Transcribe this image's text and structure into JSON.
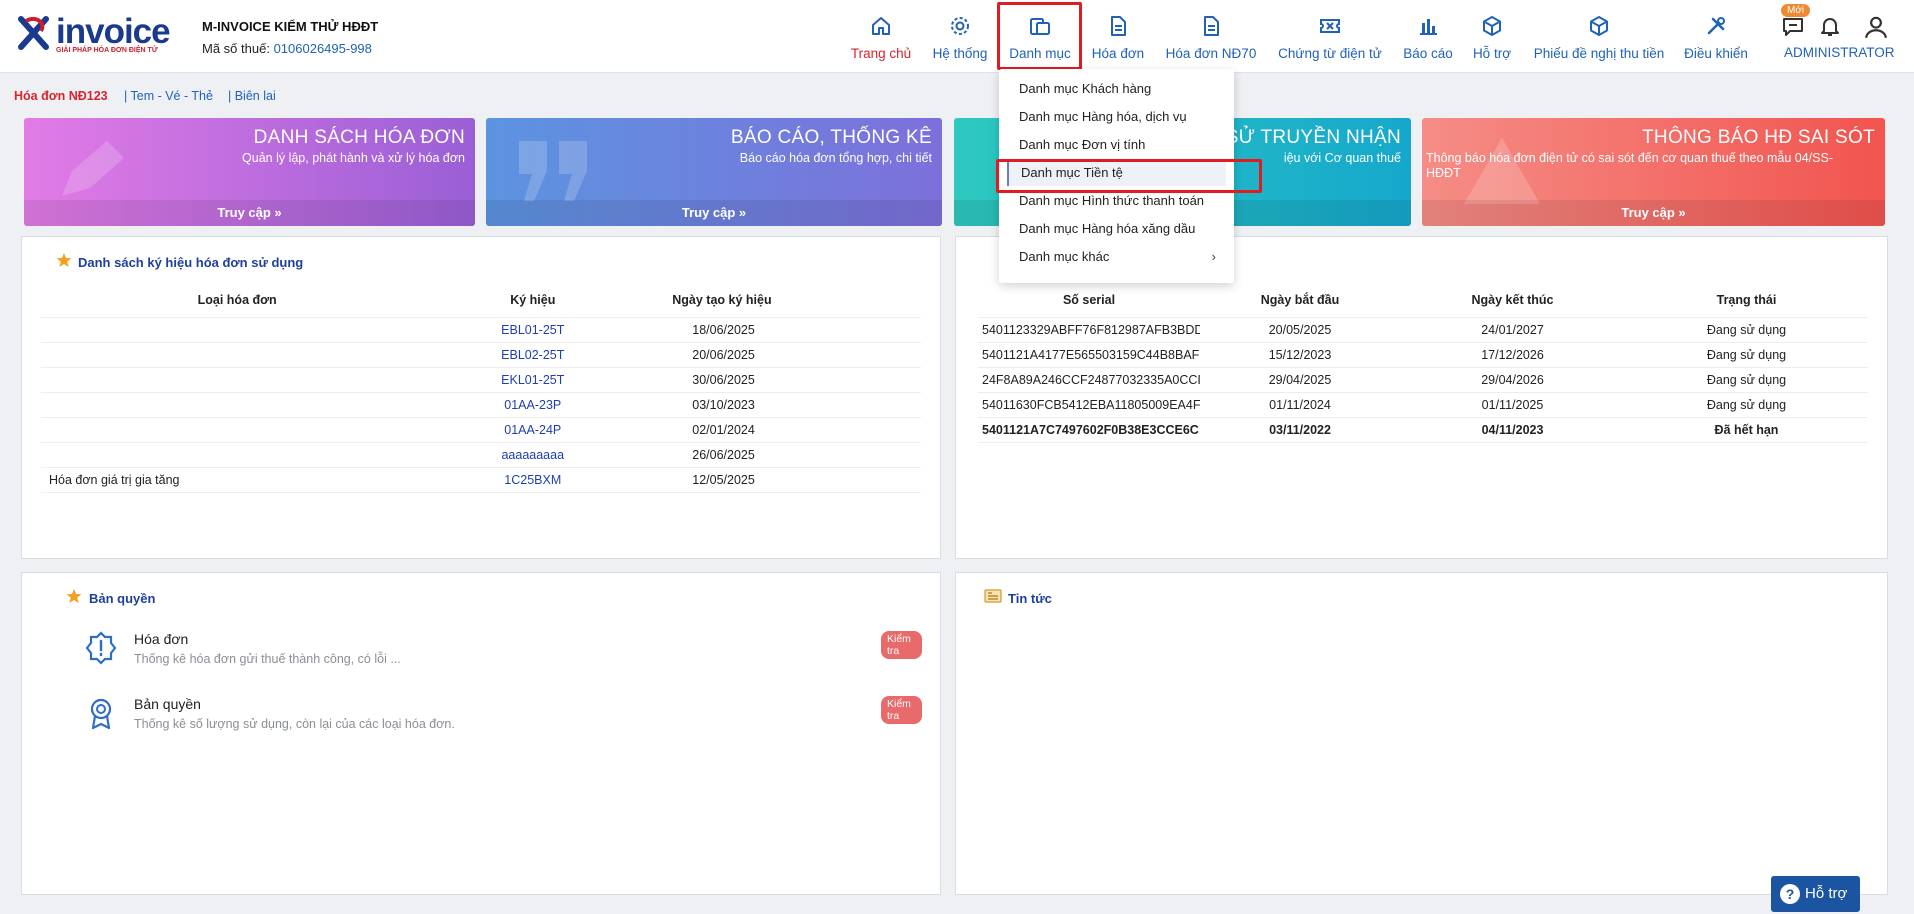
{
  "brand": {
    "logo_text": "invoice",
    "tagline": "GIẢI PHÁP HÓA ĐƠN ĐIỆN TỬ"
  },
  "company": {
    "name": "M-INVOICE KIỂM THỬ HĐĐT",
    "tax_label": "Mã số thuế:",
    "tax_code": "0106026495-998"
  },
  "nav": {
    "items": [
      {
        "label": "Trang chủ",
        "icon": "home-icon"
      },
      {
        "label": "Hệ thống",
        "icon": "gear-icon"
      },
      {
        "label": "Danh mục",
        "icon": "catalog-icon"
      },
      {
        "label": "Hóa đơn",
        "icon": "document-icon"
      },
      {
        "label": "Hóa đơn NĐ70",
        "icon": "document-icon"
      },
      {
        "label": "Chứng từ điện tử",
        "icon": "ticket-icon"
      },
      {
        "label": "Báo cáo",
        "icon": "bar-chart-icon"
      },
      {
        "label": "Hỗ trợ",
        "icon": "box-icon"
      },
      {
        "label": "Phiếu đề nghị thu tiền",
        "icon": "box-icon"
      },
      {
        "label": "Điều khiển",
        "icon": "tools-icon"
      }
    ],
    "new_badge": "Mới",
    "admin": "ADMINISTRATOR"
  },
  "subtabs": [
    "Hóa đơn NĐ123",
    "| Tem - Vé - Thẻ",
    "| Biên lai"
  ],
  "banners": [
    {
      "title": "DANH SÁCH HÓA ĐƠN",
      "desc": "Quản lý lập, phát hành và xử lý hóa đơn",
      "action": "Truy cập",
      "color": "#b55fd8"
    },
    {
      "title": "BÁO CÁO, THỐNG KÊ",
      "desc": "Báo cáo hóa đơn tổng hợp, chi tiết",
      "action": "Truy cập",
      "color": "#6b79d9"
    },
    {
      "title": "SỬ TRUYỀN NHẬN",
      "desc": "iệu với Cơ quan thuế",
      "action": "",
      "color": "#1fb8c8"
    },
    {
      "title": "THÔNG BÁO HĐ SAI SÓT",
      "desc": "Thông báo hóa đơn điện tử có sai sót đến cơ quan thuế theo mẫu 04/SS-HĐĐT",
      "action": "Truy cập",
      "color": "#f2625f"
    }
  ],
  "symbols_panel": {
    "title": "Danh sách ký hiệu hóa đơn sử dụng",
    "headers": [
      "Loại hóa đơn",
      "Ký hiệu",
      "Ngày tạo ký hiệu"
    ],
    "rows": [
      [
        "",
        "EBL01-25T",
        "18/06/2025"
      ],
      [
        "",
        "EBL02-25T",
        "20/06/2025"
      ],
      [
        "",
        "EKL01-25T",
        "30/06/2025"
      ],
      [
        "",
        "01AA-23P",
        "03/10/2023"
      ],
      [
        "",
        "01AA-24P",
        "02/01/2024"
      ],
      [
        "",
        "aaaaaaaaa",
        "26/06/2025"
      ],
      [
        "Hóa đơn giá trị gia tăng",
        "1C25BXM",
        "12/05/2025"
      ]
    ]
  },
  "certs_panel": {
    "headers": [
      "Số serial",
      "Ngày bắt đầu",
      "Ngày kết thúc",
      "Trạng thái"
    ],
    "rows": [
      [
        "5401123329ABFF76F812987AFB3BDD",
        "20/05/2025",
        "24/01/2027",
        "Đang sử dụng"
      ],
      [
        "5401121A4177E565503159C44B8BAF",
        "15/12/2023",
        "17/12/2026",
        "Đang sử dụng"
      ],
      [
        "24F8A89A246CCF24877032335A0CCI",
        "29/04/2025",
        "29/04/2026",
        "Đang sử dụng"
      ],
      [
        "54011630FCB5412EBA11805009EA4F",
        "01/11/2024",
        "01/11/2025",
        "Đang sử dụng"
      ],
      [
        "5401121A7C7497602F0B38E3CCE6C",
        "03/11/2022",
        "04/11/2023",
        "Đã hết hạn"
      ]
    ]
  },
  "license_panel": {
    "title": "Bản quyền",
    "items": [
      {
        "name": "Hóa đơn",
        "desc": "Thống kê hóa đơn gửi thuế thành công, có lỗi ...",
        "action": "Kiểm tra"
      },
      {
        "name": "Bản quyền",
        "desc": "Thống kê số lượng sử dụng, còn lại của các loại hóa đơn.",
        "action": "Kiểm tra"
      }
    ]
  },
  "news_panel": {
    "title": "Tin tức"
  },
  "dropdown": {
    "items": [
      "Danh mục Khách hàng",
      "Danh mục Hàng hóa, dịch vụ",
      "Danh mục Đơn vị tính",
      "Danh mục Tiền tệ",
      "Danh mục Hình thức thanh toán",
      "Danh mục Hàng hóa xăng dầu",
      "Danh mục khác"
    ],
    "selected_index": 3
  },
  "help_button": "Hỗ trợ",
  "colors": {
    "primary": "#1f62b8",
    "accent_red": "#d9242f",
    "highlight_box": "#e01b22"
  }
}
